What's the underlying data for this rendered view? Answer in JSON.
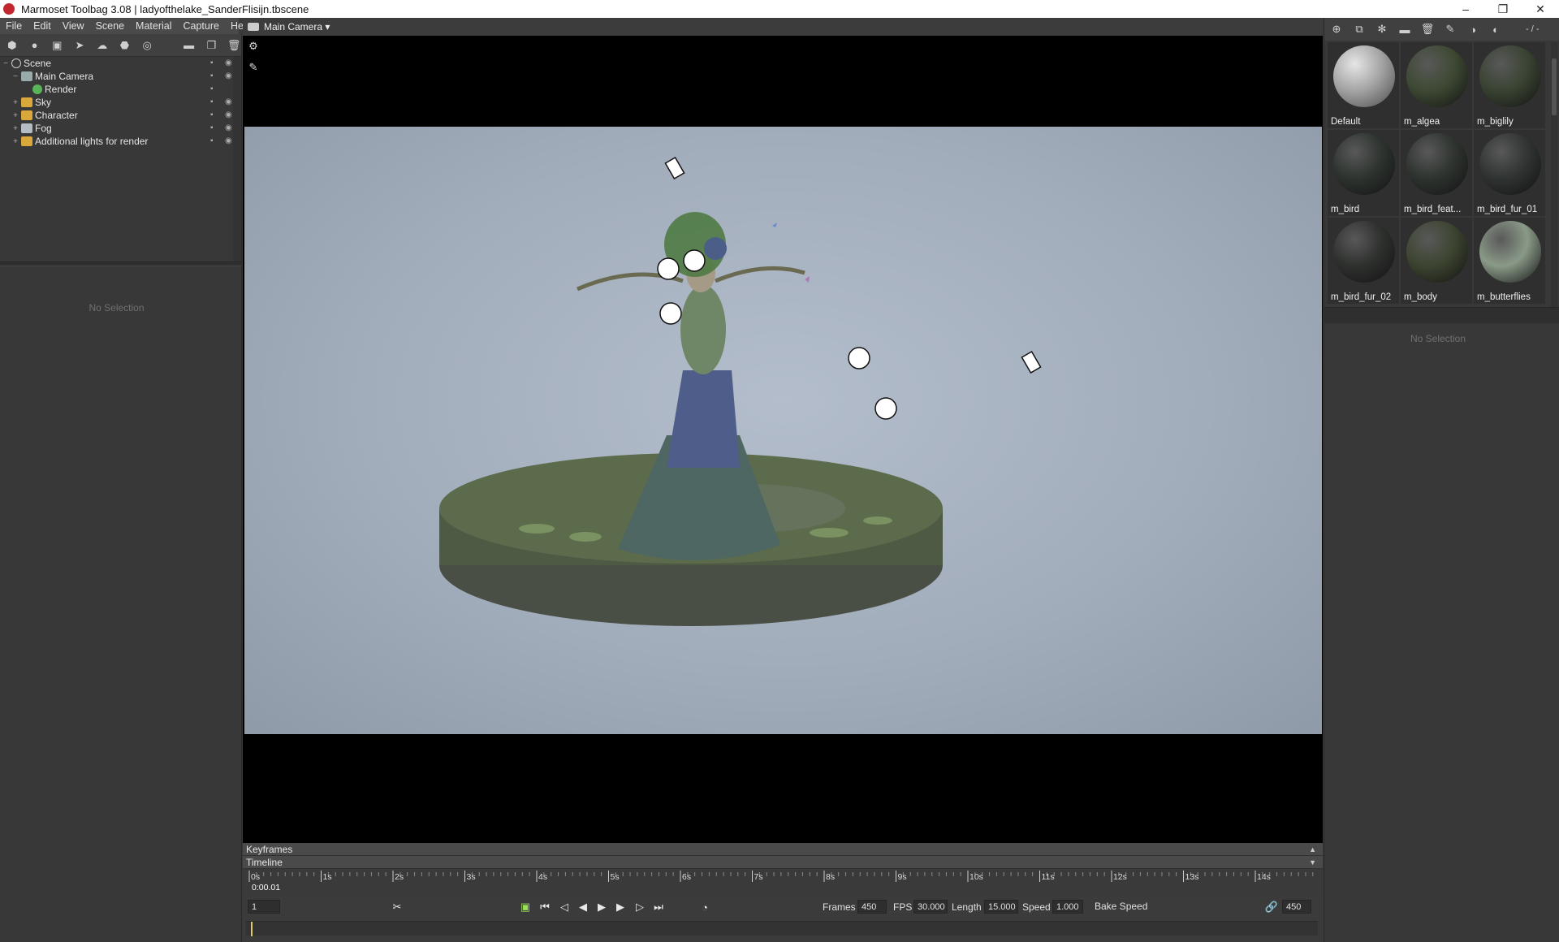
{
  "window": {
    "title": "Marmoset Toolbag 3.08  |  ladyofthelake_SanderFlisijn.tbscene",
    "controls": [
      "–",
      "❐",
      "✕"
    ]
  },
  "menu": [
    "File",
    "Edit",
    "View",
    "Scene",
    "Material",
    "Capture",
    "Help"
  ],
  "scene_tree": [
    {
      "label": "Scene",
      "icon": "scene-icon",
      "level": 0
    },
    {
      "label": "Main Camera",
      "icon": "camera-icon",
      "level": 1
    },
    {
      "label": "Render",
      "icon": "render-icon",
      "level": 2
    },
    {
      "label": "Sky",
      "icon": "sky-folder-icon",
      "level": 1
    },
    {
      "label": "Character",
      "icon": "folder-icon",
      "level": 1
    },
    {
      "label": "Fog",
      "icon": "fog-icon",
      "level": 1
    },
    {
      "label": "Additional lights for render",
      "icon": "folder-icon",
      "level": 1
    }
  ],
  "left_properties": {
    "empty_text": "No Selection"
  },
  "viewport": {
    "camera_label": "Main Camera ▾"
  },
  "timeline": {
    "keyframes_label": "Keyframes",
    "timeline_label": "Timeline",
    "ticks": [
      "0s",
      "1s",
      "2s",
      "3s",
      "4s",
      "5s",
      "6s",
      "7s",
      "8s",
      "9s",
      "10s",
      "11s",
      "12s",
      "13s",
      "14s"
    ],
    "current_time": "0:00.01",
    "frame": "1",
    "frames_label": "Frames",
    "frames_value": "450",
    "fps_label": "FPS",
    "fps_value": "30.000",
    "length_label": "Length",
    "length_value": "15.000",
    "speed_label": "Speed",
    "speed_value": "1.000",
    "bake_speed_label": "Bake Speed",
    "end_frame": "450"
  },
  "materials": {
    "counter": "- / -",
    "items": [
      {
        "name": "Default",
        "color": "#9c9c9c"
      },
      {
        "name": "m_algea",
        "color": "#3e4a34"
      },
      {
        "name": "m_biglily",
        "color": "#3a4433"
      },
      {
        "name": "m_bird",
        "color": "#2e3430"
      },
      {
        "name": "m_bird_feat...",
        "color": "#2f3430"
      },
      {
        "name": "m_bird_fur_01",
        "color": "#303432"
      },
      {
        "name": "m_bird_fur_02",
        "color": "#2f312f"
      },
      {
        "name": "m_body",
        "color": "#3d4531"
      },
      {
        "name": "m_butterflies",
        "color": "#8a9a88"
      }
    ]
  },
  "right_properties": {
    "empty_text": "No Selection"
  }
}
